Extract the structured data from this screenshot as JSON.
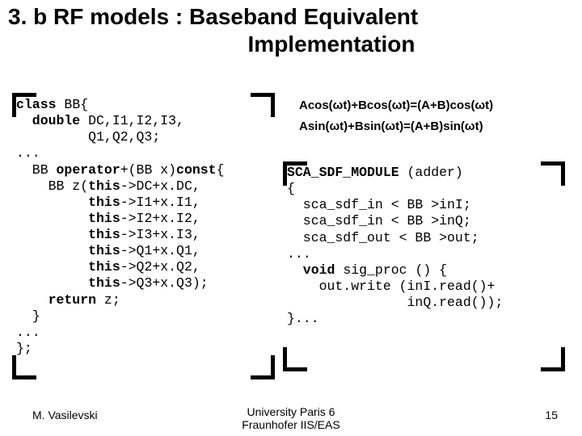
{
  "title": {
    "line1": "3. b RF models : Baseband Equivalent",
    "line2": "Implementation"
  },
  "formulas": {
    "line1": "Acos(ωt)+Bcos(ωt)=(A+B)cos(ωt)",
    "line2": "Asin(ωt)+Bsin(ωt)=(A+B)sin(ωt)"
  },
  "code_left": {
    "l01a": "class",
    "l01b": " BB{",
    "l02a": "  double",
    "l02b": " DC,I1,I2,I3,",
    "l03": "         Q1,Q2,Q3;",
    "l04": "...",
    "l05a": "  BB ",
    "l05b": "operator",
    "l05c": "+(BB x)",
    "l05d": "const",
    "l05e": "{",
    "l06a": "    BB z(",
    "l06b": "this",
    "l06c": "->DC+x.DC,",
    "l07a": "         ",
    "l07b": "this",
    "l07c": "->I1+x.I1,",
    "l08a": "         ",
    "l08b": "this",
    "l08c": "->I2+x.I2,",
    "l09a": "         ",
    "l09b": "this",
    "l09c": "->I3+x.I3,",
    "l10a": "         ",
    "l10b": "this",
    "l10c": "->Q1+x.Q1,",
    "l11a": "         ",
    "l11b": "this",
    "l11c": "->Q2+x.Q2,",
    "l12a": "         ",
    "l12b": "this",
    "l12c": "->Q3+x.Q3);",
    "l13a": "    return",
    "l13b": " z;",
    "l14": "  }",
    "l15": "...",
    "l16": "};"
  },
  "code_right": {
    "l01a": "SCA_SDF_MODULE",
    "l01b": " (adder)",
    "l02": "{",
    "l03": "  sca_sdf_in < BB >inI;",
    "l04": "  sca_sdf_in < BB >inQ;",
    "l05": "  sca_sdf_out < BB >out;",
    "l06": "...",
    "l07a": "  void",
    "l07b": " sig_proc () {",
    "l08": "    out.write (inI.read()+",
    "l09": "               inQ.read());",
    "l10": "}..."
  },
  "footer": {
    "left": "M. Vasilevski",
    "center1": "University Paris 6",
    "center2": "Fraunhofer IIS/EAS",
    "right": "15"
  }
}
